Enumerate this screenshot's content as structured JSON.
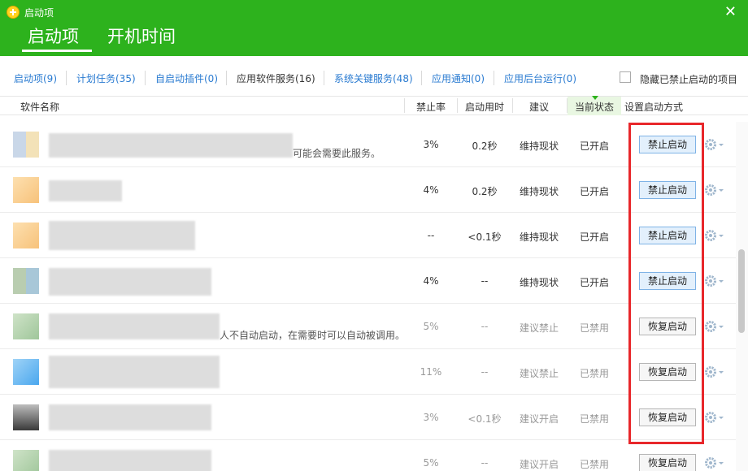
{
  "window": {
    "title": "启动项",
    "close_glyph": "✕"
  },
  "main_tabs": [
    {
      "label": "启动项",
      "active": true
    },
    {
      "label": "开机时间",
      "active": false
    }
  ],
  "sub_tabs": [
    {
      "label": "启动项(9)"
    },
    {
      "label": "计划任务(35)"
    },
    {
      "label": "自启动插件(0)"
    },
    {
      "label": "应用软件服务(16)",
      "active": true
    },
    {
      "label": "系统关键服务(48)"
    },
    {
      "label": "应用通知(0)"
    },
    {
      "label": "应用后台运行(0)"
    }
  ],
  "hide_disabled": {
    "label": "隐藏已禁止启动的项目",
    "checked": false
  },
  "columns": {
    "name": "软件名称",
    "rate": "禁止率",
    "time": "启动用时",
    "advice": "建议",
    "state": "当前状态",
    "action": "设置启动方式"
  },
  "rows": [
    {
      "desc": "可能会需要此服务。",
      "rate": "3%",
      "time": "0.2秒",
      "advice": "维持现状",
      "state": "已开启",
      "action": "禁止启动",
      "enabled": true
    },
    {
      "desc": "",
      "rate": "4%",
      "time": "0.2秒",
      "advice": "维持现状",
      "state": "已开启",
      "action": "禁止启动",
      "enabled": true
    },
    {
      "desc": "",
      "rate": "--",
      "time": "<0.1秒",
      "advice": "维持现状",
      "state": "已开启",
      "action": "禁止启动",
      "enabled": true
    },
    {
      "desc": "",
      "rate": "4%",
      "time": "--",
      "advice": "维持现状",
      "state": "已开启",
      "action": "禁止启动",
      "enabled": true
    },
    {
      "desc": "人不自动启动，在需要时可以自动被调用。",
      "rate": "5%",
      "time": "--",
      "advice": "建议禁止",
      "state": "已禁用",
      "action": "恢复启动",
      "enabled": false
    },
    {
      "desc": "",
      "rate": "11%",
      "time": "--",
      "advice": "建议禁止",
      "state": "已禁用",
      "action": "恢复启动",
      "enabled": false
    },
    {
      "desc": "",
      "rate": "3%",
      "time": "<0.1秒",
      "advice": "建议开启",
      "state": "已禁用",
      "action": "恢复启动",
      "enabled": false
    },
    {
      "desc": "",
      "rate": "5%",
      "time": "--",
      "advice": "建议开启",
      "state": "已禁用",
      "action": "恢复启动",
      "enabled": false
    }
  ],
  "colors": {
    "header_green": "#2db21d",
    "link_blue": "#2a7bd1",
    "highlight_red": "#e8272b",
    "disable_btn_bg": "#e3f0fc",
    "restore_btn_bg": "#f6f6f6"
  },
  "icons": [
    "app-logo-icon",
    "close-icon",
    "gear-icon",
    "dropdown-caret-icon",
    "checkbox-icon"
  ]
}
